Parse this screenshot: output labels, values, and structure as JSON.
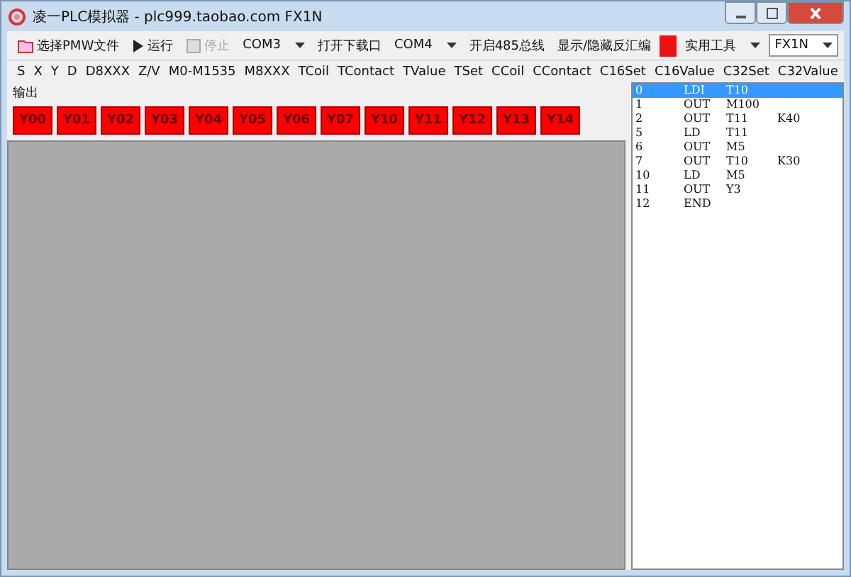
{
  "window": {
    "title": "凌一PLC模拟器 - plc999.taobao.com  FX1N"
  },
  "toolbar": [
    {
      "kind": "button",
      "label": "选择PMW文件"
    },
    {
      "kind": "button",
      "label": "运行",
      "disabled": false
    },
    {
      "kind": "button",
      "label": "停止",
      "disabled": true
    },
    {
      "kind": "dropdown",
      "value": "COM3"
    },
    {
      "kind": "button",
      "label": "打开下载口"
    },
    {
      "kind": "dropdown",
      "value": "COM4"
    },
    {
      "kind": "button",
      "label": "开启485总线"
    },
    {
      "kind": "button",
      "label": "显示/隐藏反汇编"
    },
    {
      "kind": "indicator",
      "color": "#ee1111"
    },
    {
      "kind": "menu",
      "label": "实用工具"
    },
    {
      "kind": "combobox",
      "value": "FX1N"
    }
  ],
  "tabs": [
    "S",
    "X",
    "Y",
    "D",
    "D8XXX",
    "Z/V",
    "M0-M1535",
    "M8XXX",
    "TCoil",
    "TContact",
    "TValue",
    "TSet",
    "CCoil",
    "CContact",
    "C16Set",
    "C16Value",
    "C32Set",
    "C32Value"
  ],
  "output": {
    "label": "输出",
    "coils": [
      {
        "label": "Y00",
        "on": true
      },
      {
        "label": "Y01",
        "on": true
      },
      {
        "label": "Y02",
        "on": true
      },
      {
        "label": "Y03",
        "on": true
      },
      {
        "label": "Y04",
        "on": true
      },
      {
        "label": "Y05",
        "on": true
      },
      {
        "label": "Y06",
        "on": true
      },
      {
        "label": "Y07",
        "on": true
      },
      {
        "label": "Y10",
        "on": true
      },
      {
        "label": "Y11",
        "on": true
      },
      {
        "label": "Y12",
        "on": true
      },
      {
        "label": "Y13",
        "on": true
      },
      {
        "label": "Y14",
        "on": true
      }
    ]
  },
  "program": [
    {
      "step": "0",
      "op": "LDI",
      "operand": "T10",
      "selected": true
    },
    {
      "step": "1",
      "op": "OUT",
      "operand": "M100",
      "selected": false
    },
    {
      "step": "2",
      "op": "OUT",
      "operand": "T11",
      "value": "K40",
      "selected": false
    },
    {
      "step": "5",
      "op": "LD",
      "operand": "T11",
      "selected": false
    },
    {
      "step": "6",
      "op": "OUT",
      "operand": "M5",
      "selected": false
    },
    {
      "step": "7",
      "op": "OUT",
      "operand": "T10",
      "value": "K30",
      "selected": false
    },
    {
      "step": "10",
      "op": "LD",
      "operand": "M5",
      "selected": false
    },
    {
      "step": "11",
      "op": "OUT",
      "operand": "Y3",
      "selected": false
    },
    {
      "step": "12",
      "op": "END",
      "selected": false
    }
  ]
}
